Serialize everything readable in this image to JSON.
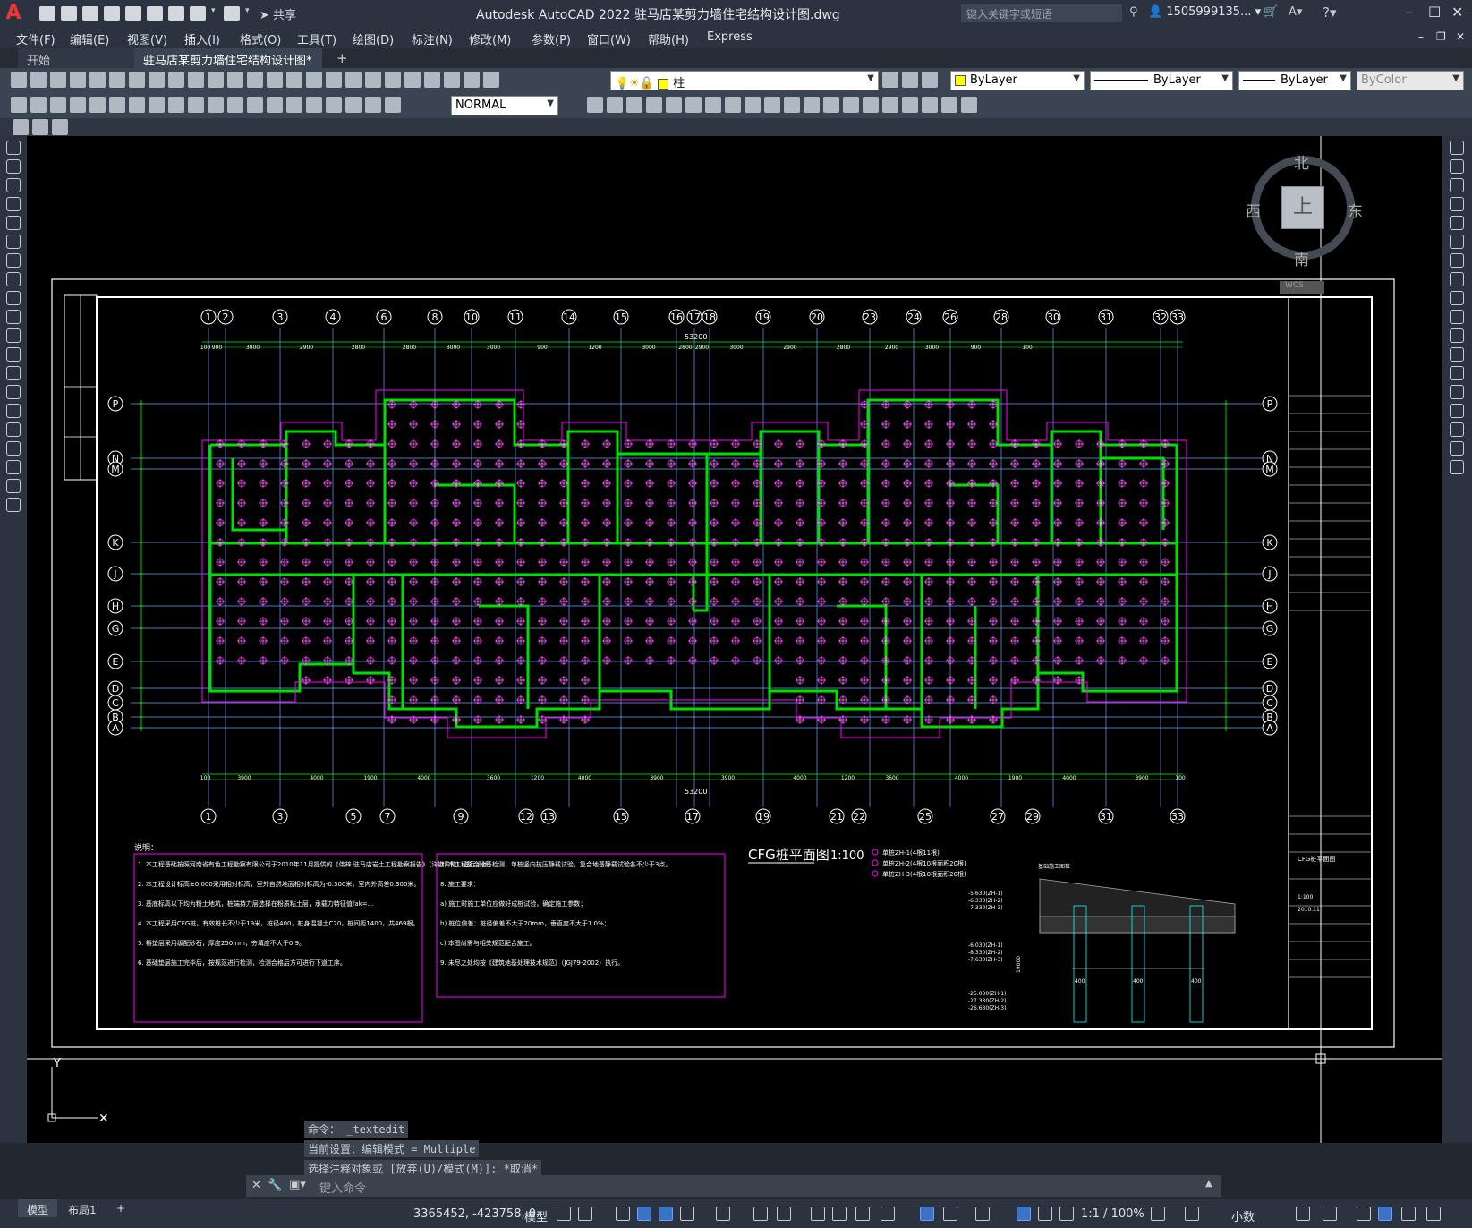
{
  "app": {
    "title": "Autodesk AutoCAD 2022    驻马店某剪力墙住宅结构设计图.dwg",
    "share_label": "共享",
    "search_placeholder": "键入关键字或短语",
    "user": "1505999135...",
    "logo": "A"
  },
  "menu": [
    "文件(F)",
    "编辑(E)",
    "视图(V)",
    "插入(I)",
    "格式(O)",
    "工具(T)",
    "绘图(D)",
    "标注(N)",
    "修改(M)",
    "参数(P)",
    "窗口(W)",
    "帮助(H)",
    "Express"
  ],
  "tabs": {
    "start": "开始",
    "active": "驻马店某剪力墙住宅结构设计图*"
  },
  "properties": {
    "layer": "柱",
    "color": "ByLayer",
    "linetype": "ByLayer",
    "lineweight": "ByLayer",
    "plotstyle": "ByColor",
    "dimstyle": "NORMAL"
  },
  "viewcube": {
    "north": "北",
    "south": "南",
    "east": "东",
    "west": "西",
    "top": "上",
    "wcs": "WCS"
  },
  "drawing": {
    "top_grid": [
      "1",
      "2",
      "3",
      "4",
      "6",
      "8",
      "10",
      "11",
      "14",
      "15",
      "16",
      "17",
      "18",
      "19",
      "20",
      "23",
      "24",
      "26",
      "28",
      "30",
      "31",
      "32",
      "33"
    ],
    "bottom_grid": [
      "1",
      "3",
      "5",
      "7",
      "9",
      "12",
      "13",
      "15",
      "17",
      "19",
      "21",
      "22",
      "25",
      "27",
      "29",
      "31",
      "33"
    ],
    "row_grid": [
      "P",
      "N",
      "M",
      "K",
      "J",
      "H",
      "G",
      "E",
      "D",
      "C",
      "B",
      "A"
    ],
    "overall_dim": "53200",
    "plan_title": "CFG桩平面图",
    "plan_scale": "1:100",
    "notes_heading": "说明：",
    "legend": [
      "单桩ZH-1(4根11根)",
      "单桩ZH-2(4根10根面积20根)",
      "单桩ZH-3(4根10根面积20根)"
    ],
    "notes_left": [
      "1. 本工程基础按照河南省有色工程勘察有限公司于2010年11月提供的《伟梓 驻马店岩土工程勘察报告》（详勘阶段）进行设计。",
      "2. 本工程设计标高±0.000采用相对标高，室外自然地面相对标高为-0.300米，室内外高差0.300米。",
      "3. 基底标高以下均为粉土地坑，桩端持力层选择在粉质粘土层，承载力特征值fak=...",
      "4. 本工程采用CFG桩，有效桩长不少于19米，桩径400，桩身混凝土C20，桩间距1400，共469根。",
      "5. 褥垫层采用级配砂石，厚度250mm，夯填度不大于0.9。",
      "6. 基础垫层施工完毕后，按规范进行检测，检测合格后方可进行下道工序。"
    ],
    "notes_right": [
      "7. 本工程复合地基检测，单桩竖向抗压静载试验，复合地基静载试验各不少于3点。",
      "8. 施工要求：",
      "a) 施工时施工单位应做好成桩试验，确定施工参数；",
      "b) 桩位偏差：桩径偏差不大于20mm，垂直度不大于1.0%；",
      "c) 本图尚需与相关规范配合施工。",
      "9. 未尽之处均按《建筑地基处理技术规范》（JGJ79-2002）执行。"
    ],
    "section_levels": [
      "-5.630(ZH-1)",
      "-6.330(ZH-2)",
      "-7.330(ZH-3)",
      "-6.030(ZH-1)",
      "-8.330(ZH-2)",
      "-7.630(ZH-3)",
      "-25.030(ZH-1)",
      "-27.330(ZH-2)",
      "-26.630(ZH-3)"
    ],
    "section_dims": [
      "400",
      "400",
      "400",
      "19000"
    ],
    "section_title": "基础施工图桩",
    "titleblock_drawing_name": "CFG桩平面图",
    "titleblock_scale": "1:100",
    "titleblock_date": "2010.11",
    "top_dims": [
      "100",
      "900",
      "3000",
      "2900",
      "2800",
      "2800",
      "3000",
      "3000",
      "900",
      "1200",
      "3000",
      "2800",
      "2900",
      "3000",
      "2900",
      "2800",
      "2900",
      "3000",
      "900",
      "100"
    ],
    "bottom_dims": [
      "100",
      "3900",
      "4000",
      "1900",
      "4000",
      "3600",
      "1200",
      "4000",
      "3900",
      "3900",
      "4000",
      "1200",
      "3600",
      "4000",
      "1900",
      "4000",
      "3900",
      "100"
    ]
  },
  "command": {
    "history": [
      "命令： _textedit",
      "当前设置：编辑模式 = Multiple",
      "选择注释对象或 [放弃(U)/模式(M)]: *取消*"
    ],
    "placeholder": "键入命令"
  },
  "status": {
    "layout_model": "模型",
    "layout_1": "布局1",
    "add_layout": "+",
    "coords": "3365452, -423758, 0",
    "space": "模型",
    "scale": "1:1 / 100%",
    "units": "小数"
  },
  "colors": {
    "pile": "#ff00ff",
    "wall": "#00e000",
    "grid": "#6aa0ff",
    "text": "#ffffff",
    "dim": "#00ff00",
    "bg": "#000000"
  }
}
